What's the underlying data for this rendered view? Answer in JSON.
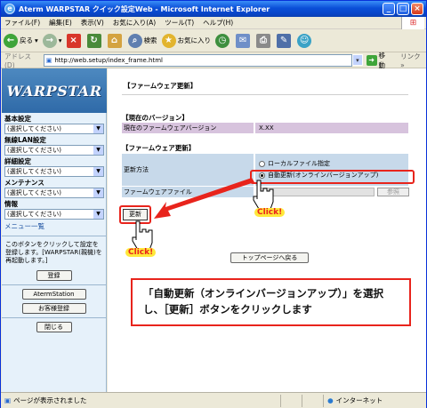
{
  "window": {
    "title": "Aterm WARPSTAR クイック設定Web - Microsoft Internet Explorer",
    "minimize": "_",
    "maximize": "□",
    "close": "×"
  },
  "menubar": [
    "ファイル(F)",
    "編集(E)",
    "表示(V)",
    "お気に入り(A)",
    "ツール(T)",
    "ヘルプ(H)"
  ],
  "toolbar": {
    "back": "戻る",
    "search": "検索",
    "favorites": "お気に入り"
  },
  "address": {
    "label": "アドレス(D)",
    "url": "http://web.setup/index_frame.html",
    "go": "移動",
    "links": "リンク »"
  },
  "sidebar": {
    "logo": "WARPSTAR",
    "sections": [
      {
        "label": "基本設定",
        "value": "(選択してください)"
      },
      {
        "label": "無線LAN設定",
        "value": "(選択してください)"
      },
      {
        "label": "詳細設定",
        "value": "(選択してください)"
      },
      {
        "label": "メンテナンス",
        "value": "(選択してください)"
      },
      {
        "label": "情報",
        "value": "(選択してください)"
      }
    ],
    "menu_list": "メニュー一覧",
    "note": "このボタンをクリックして設定を登録します。[WARPSTAR(親機)を再起動します。]",
    "register": "登録",
    "aterm_station": "AtermStation",
    "customer_register": "お客様登録",
    "close": "閉じる"
  },
  "main": {
    "page_title": "【ファームウェア更新】",
    "current_version": {
      "title": "【現在のバージョン】",
      "label": "現在のファームウェアバージョン",
      "value": "X.XX"
    },
    "update": {
      "title": "【ファームウェア更新】",
      "method_label": "更新方法",
      "option_local": "ローカルファイル指定",
      "option_auto": "自動更新(オンラインバージョンアップ)",
      "file_label": "ファームウェアファイル",
      "browse": "参照",
      "update_button": "更新"
    },
    "top_page": "トップページへ戻る",
    "click_label_1": "Click!",
    "click_label_2": "Click!",
    "instruction": "「自動更新（オンラインバージョンアップ）」を選択し、［更新］ボタンをクリックします"
  },
  "statusbar": {
    "text": "ページが表示されました",
    "zone": "インターネット"
  },
  "colors": {
    "accent": "#e8241c",
    "titlebar": "#0a4fd8",
    "sidebar_bg": "#e6f1fa"
  }
}
